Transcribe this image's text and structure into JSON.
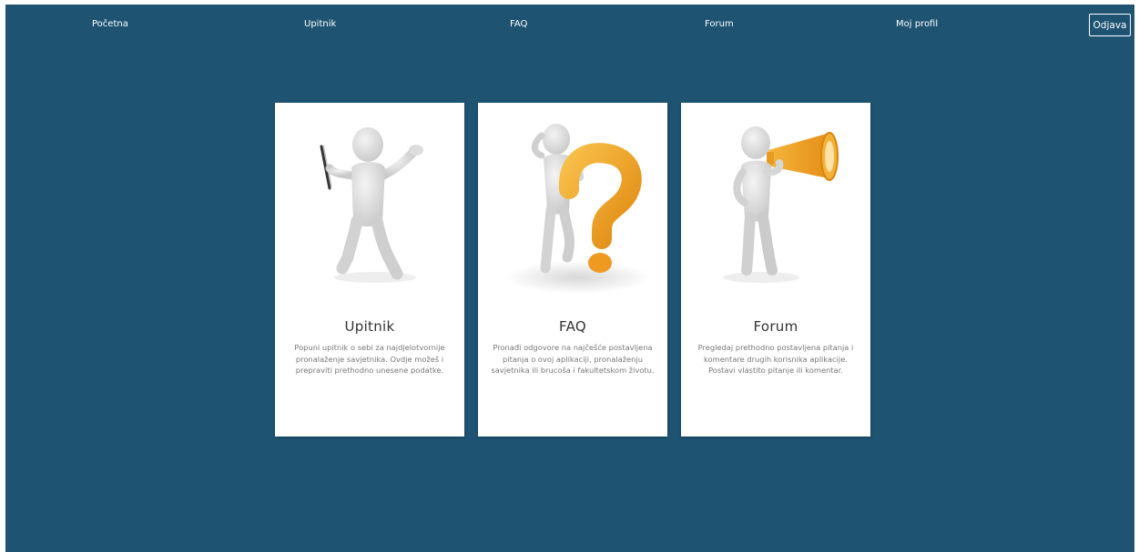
{
  "nav": {
    "home": "Početna",
    "questionnaire": "Upitnik",
    "faq": "FAQ",
    "forum": "Forum",
    "profile": "Moj profil",
    "logout": "Odjava"
  },
  "cards": [
    {
      "title": "Upitnik",
      "text": "Popuni upitnik o sebi za najdjelotvornije pronalaženje savjetnika. Ovdje možeš i prepraviti prethodno unesene podatke.",
      "image": "person-with-clipboard-icon"
    },
    {
      "title": "FAQ",
      "text": "Pronađi odgovore na najčešće postavljena pitanja o ovoj aplikaciji, pronalaženju savjetnika ili brucoša i fakultetskom životu.",
      "image": "person-with-question-mark-icon"
    },
    {
      "title": "Forum",
      "text": "Pregledaj prethodno postavljena pitanja i komentare drugih korisnika aplikacije. Postavi vlastito pitanje ili komentar.",
      "image": "person-with-megaphone-icon"
    }
  ],
  "colors": {
    "page_background": "#1e5372",
    "card_background": "#ffffff",
    "accent_orange": "#f0a02a"
  }
}
